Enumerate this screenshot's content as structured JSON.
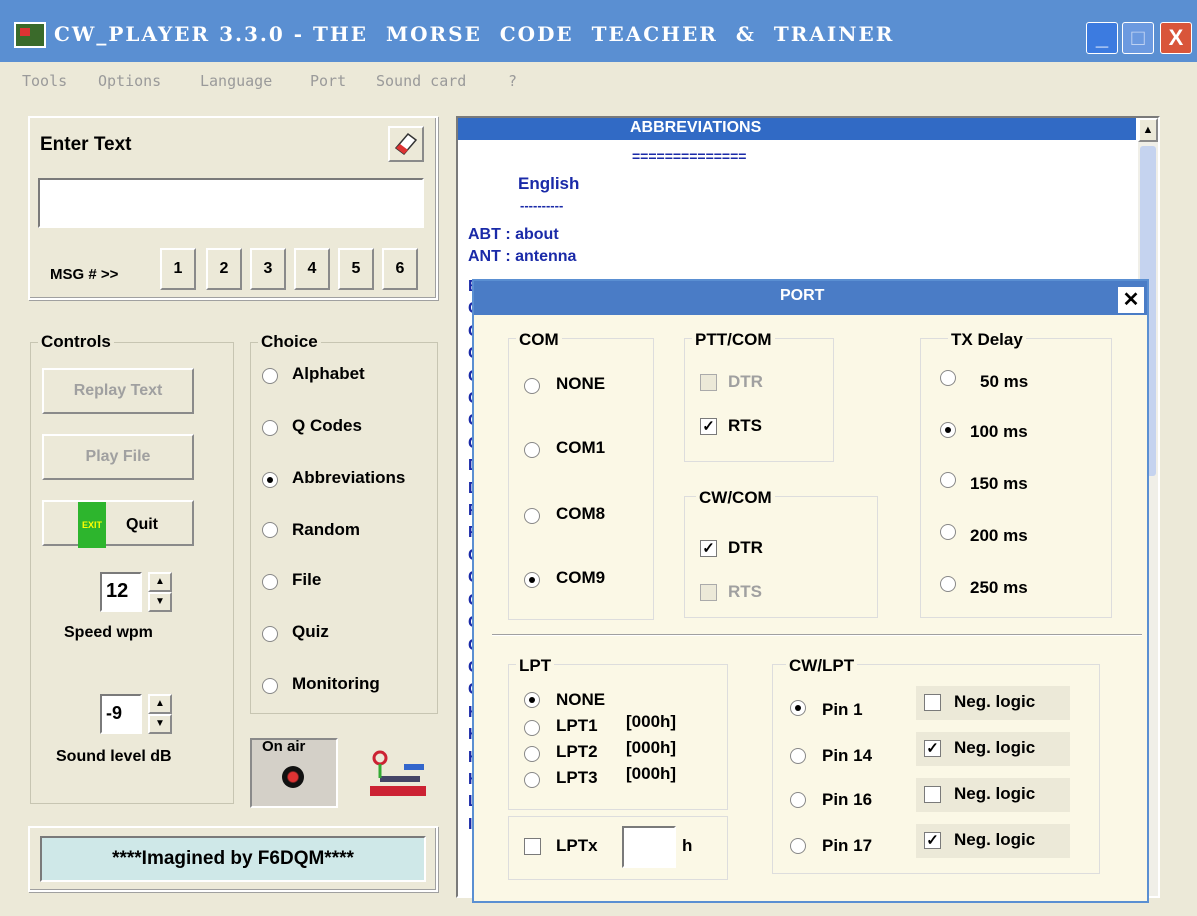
{
  "window": {
    "title": "CW_PLAYER 3.3.0 - THE  MORSE  CODE  TEACHER  &  TRAINER",
    "minimize": "_",
    "maximize": "□",
    "close": "X"
  },
  "menu": [
    "Tools",
    "Options",
    "Language",
    "Port",
    "Sound card",
    "?"
  ],
  "enter_text": {
    "title": "Enter Text",
    "value": "",
    "msg_label": "MSG # >>",
    "msg_buttons": [
      "1",
      "2",
      "3",
      "4",
      "5",
      "6"
    ]
  },
  "controls": {
    "legend": "Controls",
    "replay": "Replay Text",
    "play_file": "Play File",
    "quit": "Quit",
    "quit_badge": "EXIT",
    "speed_value": "12",
    "speed_label": "Speed  wpm",
    "sound_value": "-9",
    "sound_label": "Sound level dB"
  },
  "choice": {
    "legend": "Choice",
    "options": [
      "Alphabet",
      "Q Codes",
      "Abbreviations",
      "Random",
      "File",
      "Quiz",
      "Monitoring"
    ],
    "selected": "Abbreviations"
  },
  "onair": {
    "legend": "On air"
  },
  "footer": {
    "text": "****Imagined by F6DQM****"
  },
  "abbrev": {
    "title": "ABBREVIATIONS",
    "underline": "==============",
    "language": "English",
    "dashes": "----------",
    "lines": [
      "ABT : about",
      "ANT : antenna"
    ],
    "initials": [
      "B",
      "C",
      "C",
      "C",
      "C",
      "C",
      "C",
      "C",
      "D",
      "D",
      "F",
      "F",
      "C",
      "C",
      "C",
      "C",
      "C",
      "C",
      "C",
      "H",
      "H",
      "H",
      "H",
      "L",
      "I"
    ]
  },
  "port": {
    "title": "PORT",
    "close": "✕",
    "com": {
      "legend": "COM",
      "options": [
        "NONE",
        "COM1",
        "COM8",
        "COM9"
      ],
      "selected": "COM9"
    },
    "pttcom": {
      "legend": "PTT/COM",
      "items": [
        {
          "label": "DTR",
          "checked": false,
          "disabled": true
        },
        {
          "label": "RTS",
          "checked": true,
          "disabled": false
        }
      ]
    },
    "cwcom": {
      "legend": "CW/COM",
      "items": [
        {
          "label": "DTR",
          "checked": true,
          "disabled": false
        },
        {
          "label": "RTS",
          "checked": false,
          "disabled": true
        }
      ]
    },
    "txdelay": {
      "legend": "TX Delay",
      "options": [
        "50 ms",
        "100 ms",
        "150 ms",
        "200 ms",
        "250 ms"
      ],
      "selected": "100 ms"
    },
    "lpt": {
      "legend": "LPT",
      "options": [
        "NONE",
        "LPT1",
        "LPT2",
        "LPT3"
      ],
      "addr": [
        "[000h]",
        "[000h]",
        "[000h]"
      ],
      "selected": "NONE"
    },
    "lptx": {
      "label": "LPTx",
      "value": "",
      "suffix": "h"
    },
    "cwlpt": {
      "legend": "CW/LPT",
      "pins": [
        "Pin 1",
        "Pin 14",
        "Pin 16",
        "Pin 17"
      ],
      "selected": "Pin 1",
      "neg": [
        {
          "label": "Neg. logic",
          "checked": false
        },
        {
          "label": "Neg. logic",
          "checked": true
        },
        {
          "label": "Neg. logic",
          "checked": false
        },
        {
          "label": "Neg. logic",
          "checked": true
        }
      ]
    }
  }
}
